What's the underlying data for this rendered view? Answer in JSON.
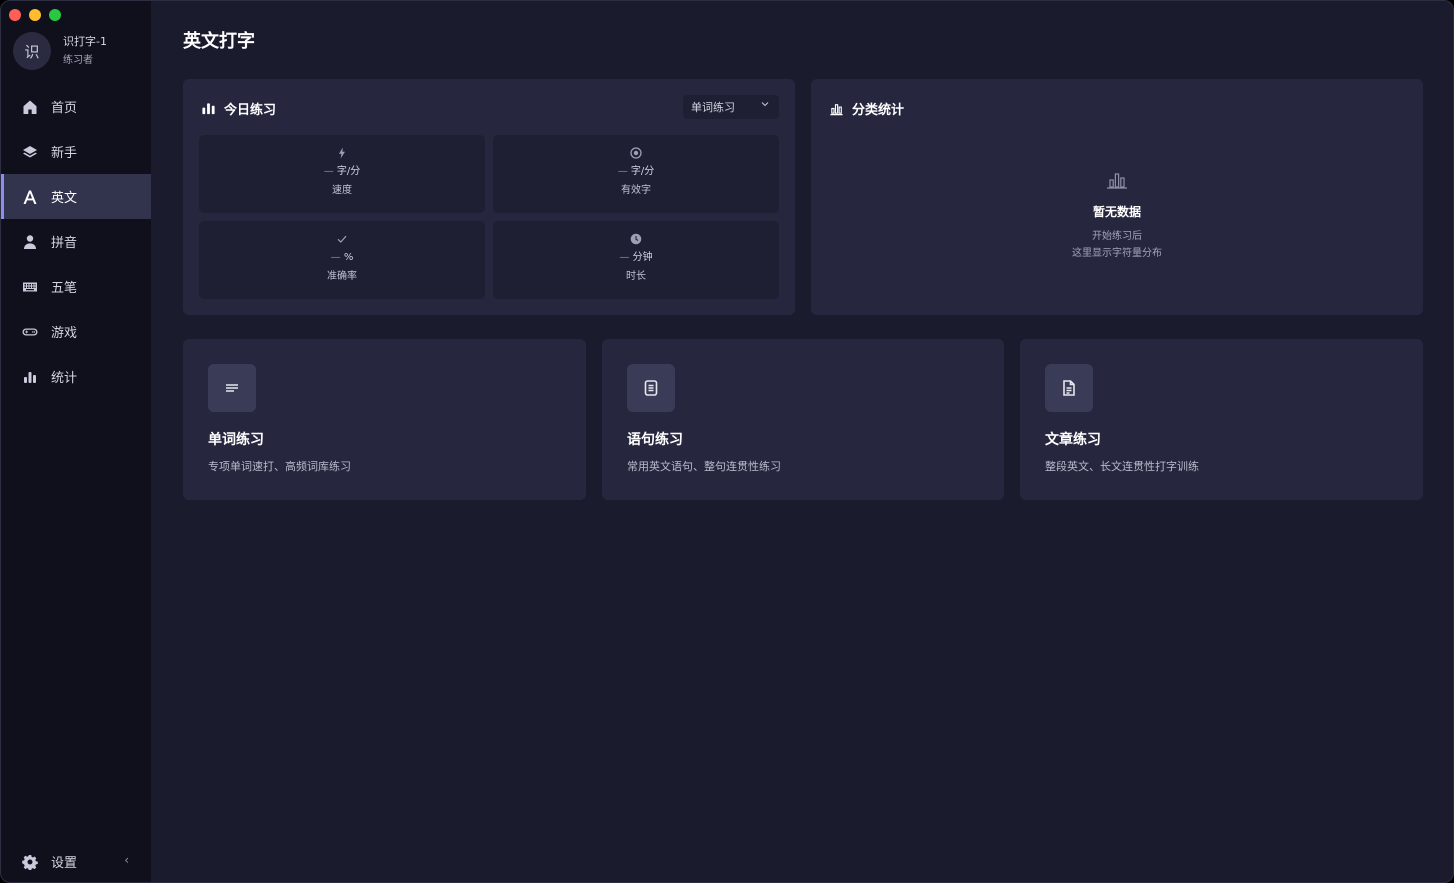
{
  "profile": {
    "avatar_char": "识",
    "name": "识打字-1",
    "role": "练习者"
  },
  "nav": {
    "items": [
      {
        "label": "首页",
        "icon": "home-icon"
      },
      {
        "label": "新手",
        "icon": "layers-icon"
      },
      {
        "label": "英文",
        "icon": "letter-a-icon",
        "active": true
      },
      {
        "label": "拼音",
        "icon": "user-icon"
      },
      {
        "label": "五笔",
        "icon": "keyboard-icon"
      },
      {
        "label": "游戏",
        "icon": "gamepad-icon"
      },
      {
        "label": "统计",
        "icon": "bar-chart-icon"
      }
    ],
    "settings_label": "设置",
    "collapse_glyph": "‹"
  },
  "page": {
    "title": "英文打字"
  },
  "today": {
    "title": "今日练习",
    "select_value": "单词练习",
    "stats": [
      {
        "icon": "lightning-icon",
        "dash": "—",
        "unit": "字/分",
        "label": "速度"
      },
      {
        "icon": "target-icon",
        "dash": "—",
        "unit": "字/分",
        "label": "有效字"
      },
      {
        "icon": "check-icon",
        "dash": "—",
        "unit": "%",
        "label": "准确率"
      },
      {
        "icon": "clock-icon",
        "dash": "—",
        "unit": "分钟",
        "label": "时长"
      }
    ]
  },
  "category": {
    "title": "分类统计",
    "empty_title": "暂无数据",
    "empty_line1": "开始练习后",
    "empty_line2": "这里显示字符量分布"
  },
  "cards": [
    {
      "title": "单词练习",
      "desc": "专项单词速打、高频词库练习",
      "icon": "lines-icon"
    },
    {
      "title": "语句练习",
      "desc": "常用英文语句、整句连贯性练习",
      "icon": "note-icon"
    },
    {
      "title": "文章练习",
      "desc": "整段英文、长文连贯性打字训练",
      "icon": "document-icon"
    }
  ],
  "colors": {
    "accent": "#8c8df0",
    "sidebar": "#10101c",
    "panel": "#26273f",
    "background": "#1b1b2e"
  }
}
